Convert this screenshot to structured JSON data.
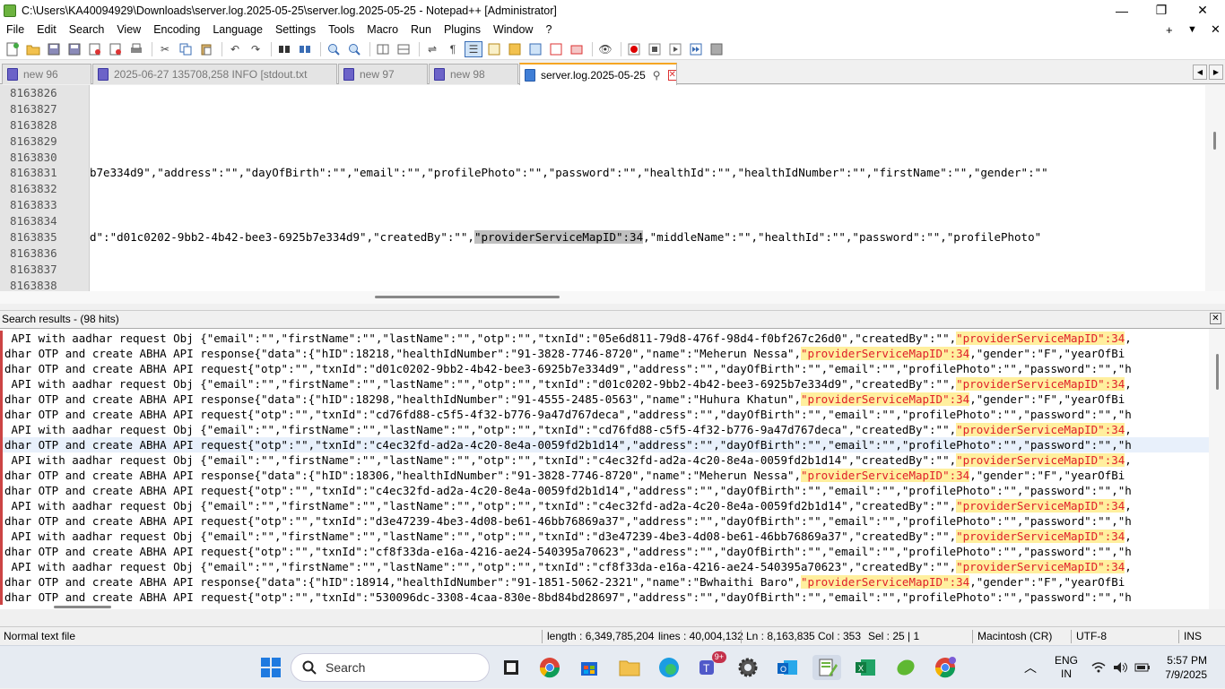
{
  "window": {
    "title": "C:\\Users\\KA40094929\\Downloads\\server.log.2025-05-25\\server.log.2025-05-25 - Notepad++ [Administrator]",
    "minimize": "—",
    "maximize": "❐",
    "close": "✕"
  },
  "menu": {
    "items": [
      "File",
      "Edit",
      "Search",
      "View",
      "Encoding",
      "Language",
      "Settings",
      "Tools",
      "Macro",
      "Run",
      "Plugins",
      "Window",
      "?"
    ],
    "right_plus": "+",
    "right_down": "▼",
    "right_close": "✕"
  },
  "tabs": [
    {
      "label": "new 96"
    },
    {
      "label": "2025-06-27 135708,258 INFO  [stdout.txt"
    },
    {
      "label": "new 97"
    },
    {
      "label": "new 98"
    },
    {
      "label": "server.log.2025-05-25",
      "active": true
    }
  ],
  "tabnav": {
    "left": "◀",
    "right": "▶"
  },
  "editor": {
    "line_numbers": [
      "8163826",
      "8163827",
      "8163828",
      "8163829",
      "8163830",
      "8163831",
      "8163832",
      "8163833",
      "8163834",
      "8163835",
      "8163836",
      "8163837",
      "8163838"
    ],
    "lines": [
      "",
      "",
      "",
      "",
      "",
      "b7e334d9\",\"address\":\"\",\"dayOfBirth\":\"\",\"email\":\"\",\"profilePhoto\":\"\",\"password\":\"\",\"healthId\":\"\",\"healthIdNumber\":\"\",\"firstName\":\"\",\"gender\":\"\"",
      "",
      "",
      "",
      "",
      "",
      "",
      ""
    ],
    "line_8163835_pre": "d\":\"d01c0202-9bb2-4b42-bee3-6925b7e334d9\",\"createdBy\":\"\",",
    "line_8163835_sel": "\"providerServiceMapID\":34",
    "line_8163835_post": ",\"middleName\":\"\",\"healthId\":\"\",\"password\":\"\",\"profilePhoto\""
  },
  "search_results": {
    "header": "Search results - (98 hits)",
    "close": "✕",
    "rows": [
      {
        "pre": " API with aadhar request Obj {\"email\":\"\",\"firstName\":\"\",\"lastName\":\"\",\"otp\":\"\",\"txnId\":\"05e6d811-79d8-476f-98d4-f0bf267c26d0\",\"createdBy\":\"\",",
        "match": "\"providerServiceMapID\":34",
        "post": ","
      },
      {
        "pre": "dhar OTP and create ABHA API response{\"data\":{\"hID\":18218,\"healthIdNumber\":\"91-3828-7746-8720\",\"name\":\"Meherun Nessa\",",
        "match": "\"providerServiceMapID\":34",
        "post": ",\"gender\":\"F\",\"yearOfBi"
      },
      {
        "pre": "dhar OTP and create ABHA API request{\"otp\":\"\",\"txnId\":\"d01c0202-9bb2-4b42-bee3-6925b7e334d9\",\"address\":\"\",\"dayOfBirth\":\"\",\"email\":\"\",\"profilePhoto\":\"\",\"password\":\"\",\"h",
        "match": "",
        "post": ""
      },
      {
        "pre": " API with aadhar request Obj {\"email\":\"\",\"firstName\":\"\",\"lastName\":\"\",\"otp\":\"\",\"txnId\":\"d01c0202-9bb2-4b42-bee3-6925b7e334d9\",\"createdBy\":\"\",",
        "match": "\"providerServiceMapID\":34",
        "post": ","
      },
      {
        "pre": "dhar OTP and create ABHA API response{\"data\":{\"hID\":18298,\"healthIdNumber\":\"91-4555-2485-0563\",\"name\":\"Huhura Khatun\",",
        "match": "\"providerServiceMapID\":34",
        "post": ",\"gender\":\"F\",\"yearOfBi"
      },
      {
        "pre": "dhar OTP and create ABHA API request{\"otp\":\"\",\"txnId\":\"cd76fd88-c5f5-4f32-b776-9a47d767deca\",\"address\":\"\",\"dayOfBirth\":\"\",\"email\":\"\",\"profilePhoto\":\"\",\"password\":\"\",\"h",
        "match": "",
        "post": ""
      },
      {
        "pre": " API with aadhar request Obj {\"email\":\"\",\"firstName\":\"\",\"lastName\":\"\",\"otp\":\"\",\"txnId\":\"cd76fd88-c5f5-4f32-b776-9a47d767deca\",\"createdBy\":\"\",",
        "match": "\"providerServiceMapID\":34",
        "post": ","
      },
      {
        "pre": "dhar OTP and create ABHA API request{\"otp\":\"\",\"txnId\":\"c4ec32fd-ad2a-4c20-8e4a-0059fd2b1d14\",\"address\":\"\",\"dayOfBirth\":\"\",\"email\":\"\",\"profilePhoto\":\"\",\"password\":\"\",\"h",
        "match": "",
        "post": "",
        "selected": true
      },
      {
        "pre": " API with aadhar request Obj {\"email\":\"\",\"firstName\":\"\",\"lastName\":\"\",\"otp\":\"\",\"txnId\":\"c4ec32fd-ad2a-4c20-8e4a-0059fd2b1d14\",\"createdBy\":\"\",",
        "match": "\"providerServiceMapID\":34",
        "post": ","
      },
      {
        "pre": "dhar OTP and create ABHA API response{\"data\":{\"hID\":18306,\"healthIdNumber\":\"91-3828-7746-8720\",\"name\":\"Meherun Nessa\",",
        "match": "\"providerServiceMapID\":34",
        "post": ",\"gender\":\"F\",\"yearOfBi"
      },
      {
        "pre": "dhar OTP and create ABHA API request{\"otp\":\"\",\"txnId\":\"c4ec32fd-ad2a-4c20-8e4a-0059fd2b1d14\",\"address\":\"\",\"dayOfBirth\":\"\",\"email\":\"\",\"profilePhoto\":\"\",\"password\":\"\",\"h",
        "match": "",
        "post": ""
      },
      {
        "pre": " API with aadhar request Obj {\"email\":\"\",\"firstName\":\"\",\"lastName\":\"\",\"otp\":\"\",\"txnId\":\"c4ec32fd-ad2a-4c20-8e4a-0059fd2b1d14\",\"createdBy\":\"\",",
        "match": "\"providerServiceMapID\":34",
        "post": ","
      },
      {
        "pre": "dhar OTP and create ABHA API request{\"otp\":\"\",\"txnId\":\"d3e47239-4be3-4d08-be61-46bb76869a37\",\"address\":\"\",\"dayOfBirth\":\"\",\"email\":\"\",\"profilePhoto\":\"\",\"password\":\"\",\"h",
        "match": "",
        "post": ""
      },
      {
        "pre": " API with aadhar request Obj {\"email\":\"\",\"firstName\":\"\",\"lastName\":\"\",\"otp\":\"\",\"txnId\":\"d3e47239-4be3-4d08-be61-46bb76869a37\",\"createdBy\":\"\",",
        "match": "\"providerServiceMapID\":34",
        "post": ","
      },
      {
        "pre": "dhar OTP and create ABHA API request{\"otp\":\"\",\"txnId\":\"cf8f33da-e16a-4216-ae24-540395a70623\",\"address\":\"\",\"dayOfBirth\":\"\",\"email\":\"\",\"profilePhoto\":\"\",\"password\":\"\",\"h",
        "match": "",
        "post": ""
      },
      {
        "pre": " API with aadhar request Obj {\"email\":\"\",\"firstName\":\"\",\"lastName\":\"\",\"otp\":\"\",\"txnId\":\"cf8f33da-e16a-4216-ae24-540395a70623\",\"createdBy\":\"\",",
        "match": "\"providerServiceMapID\":34",
        "post": ","
      },
      {
        "pre": "dhar OTP and create ABHA API response{\"data\":{\"hID\":18914,\"healthIdNumber\":\"91-1851-5062-2321\",\"name\":\"Bwhaithi Baro\",",
        "match": "\"providerServiceMapID\":34",
        "post": ",\"gender\":\"F\",\"yearOfBi"
      },
      {
        "pre": "dhar OTP and create ABHA API request{\"otp\":\"\",\"txnId\":\"530096dc-3308-4caa-830e-8bd84bd28697\",\"address\":\"\",\"dayOfBirth\":\"\",\"email\":\"\",\"profilePhoto\":\"\",\"password\":\"\",\"h",
        "match": "",
        "post": ""
      }
    ]
  },
  "statusbar": {
    "type": "Normal text file",
    "length": "length : 6,349,785,204",
    "lines": "lines : 40,004,132",
    "ln": "Ln : 8,163,835",
    "col": "Col : 353",
    "sel": "Sel : 25 | 1",
    "eol": "Macintosh (CR)",
    "encoding": "UTF-8",
    "ins": "INS"
  },
  "taskbar": {
    "search_placeholder": "Search",
    "teams_badge": "9+",
    "lang_top": "ENG",
    "lang_bottom": "IN",
    "time": "5:57 PM",
    "date": "7/9/2025"
  },
  "colors": {
    "accent_tab": "#f5a623",
    "match_bg": "#ffef9e",
    "match_fg": "#e0202a"
  }
}
